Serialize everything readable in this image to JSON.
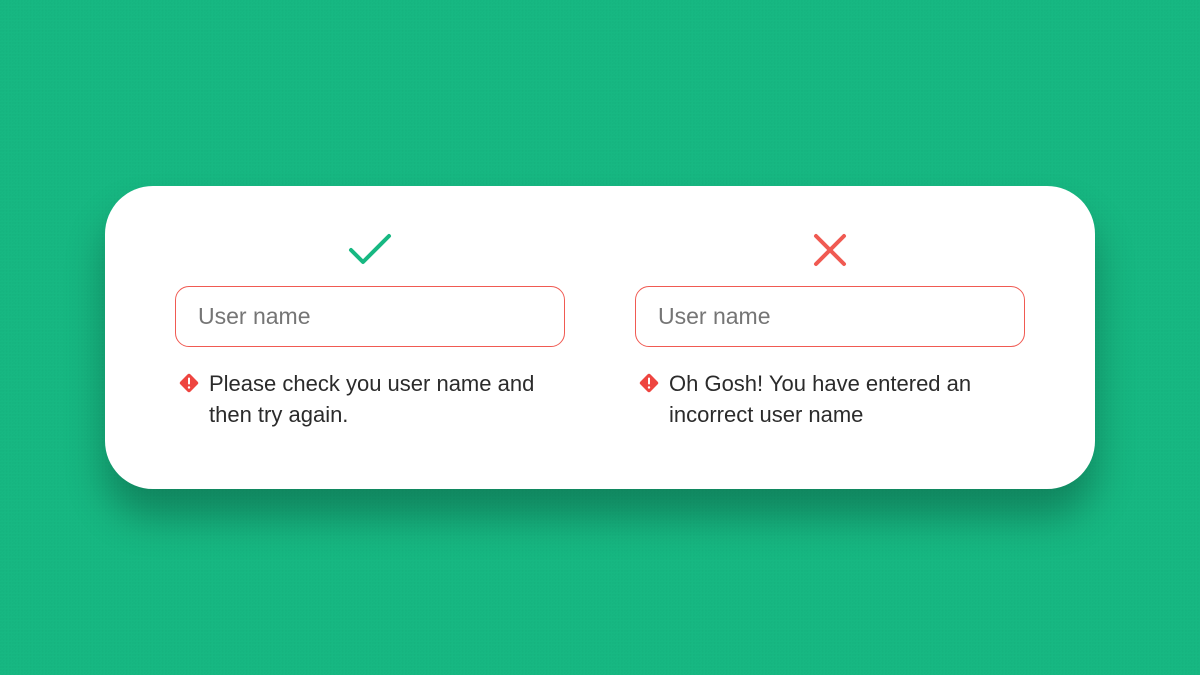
{
  "good": {
    "placeholder": "User name",
    "error_message": "Please check you user name and then try again."
  },
  "bad": {
    "placeholder": "User name",
    "error_message": "Oh Gosh! You have entered an incorrect user name"
  }
}
